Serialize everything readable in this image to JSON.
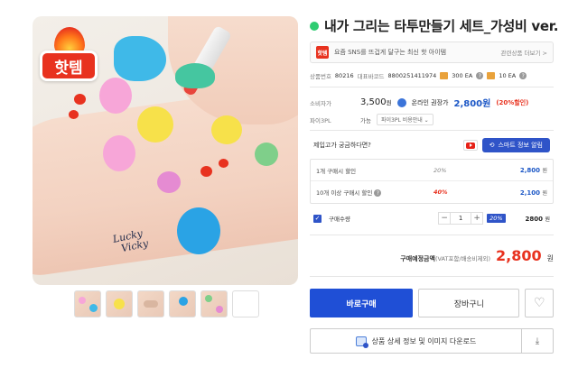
{
  "product": {
    "title": "내가 그리는 타투만들기 세트_가성비 ver.",
    "status_color": "#2ecc71"
  },
  "image": {
    "badge_text": "핫템",
    "handwriting": "Lucky\nVicky",
    "thumbnail_count": 6
  },
  "promo": {
    "badge": "핫템",
    "text": "요즘 SNS를 뜨겁게 달구는 최신 핫 아이템",
    "more": "관련상품 더보기 >"
  },
  "codes": {
    "product_no_label": "상품번호",
    "product_no": "80216",
    "barcode_label": "대표바코드",
    "barcode": "8800251411974",
    "box_qty": "300 EA",
    "inner_qty": "10 EA"
  },
  "pricing": {
    "consumer_label": "소비자가",
    "consumer_price": "3,500",
    "consumer_unit": "원",
    "online_label": "온라인 권장가",
    "online_price": "2,800원",
    "discount": "(20%할인)",
    "brand_label": "파이3PL",
    "available": "가능",
    "brand_select": "파이3PL 비용안내 ⌄"
  },
  "question": {
    "text": "제입고가 궁금하다면?",
    "smart_btn": "스마트 정보 알림"
  },
  "tiers": [
    {
      "name": "1개 구매시 할인",
      "pct": "20%",
      "amount": "2,800",
      "unit": "원",
      "red": false
    },
    {
      "name": "10개 이상 구매시 할인",
      "pct": "40%",
      "amount": "2,100",
      "unit": "원",
      "red": true
    }
  ],
  "quantity": {
    "label": "구매수량",
    "value": "1",
    "minus": "−",
    "plus": "+",
    "pct": "20%",
    "amount": "2800",
    "unit": "원"
  },
  "total": {
    "label": "구매예정금액",
    "note": "(VAT포함/배송비제외)",
    "price": "2,800",
    "unit": "원"
  },
  "buttons": {
    "buy": "바로구매",
    "cart": "장바구니",
    "wish_icon": "♡",
    "download": "상품 상세 정보 및 이미지 다운로드",
    "download_icon": "⤓"
  },
  "colors": {
    "accent_blue": "#1f4fd6",
    "price_red": "#e8321f",
    "online_blue": "#1c57c6"
  }
}
